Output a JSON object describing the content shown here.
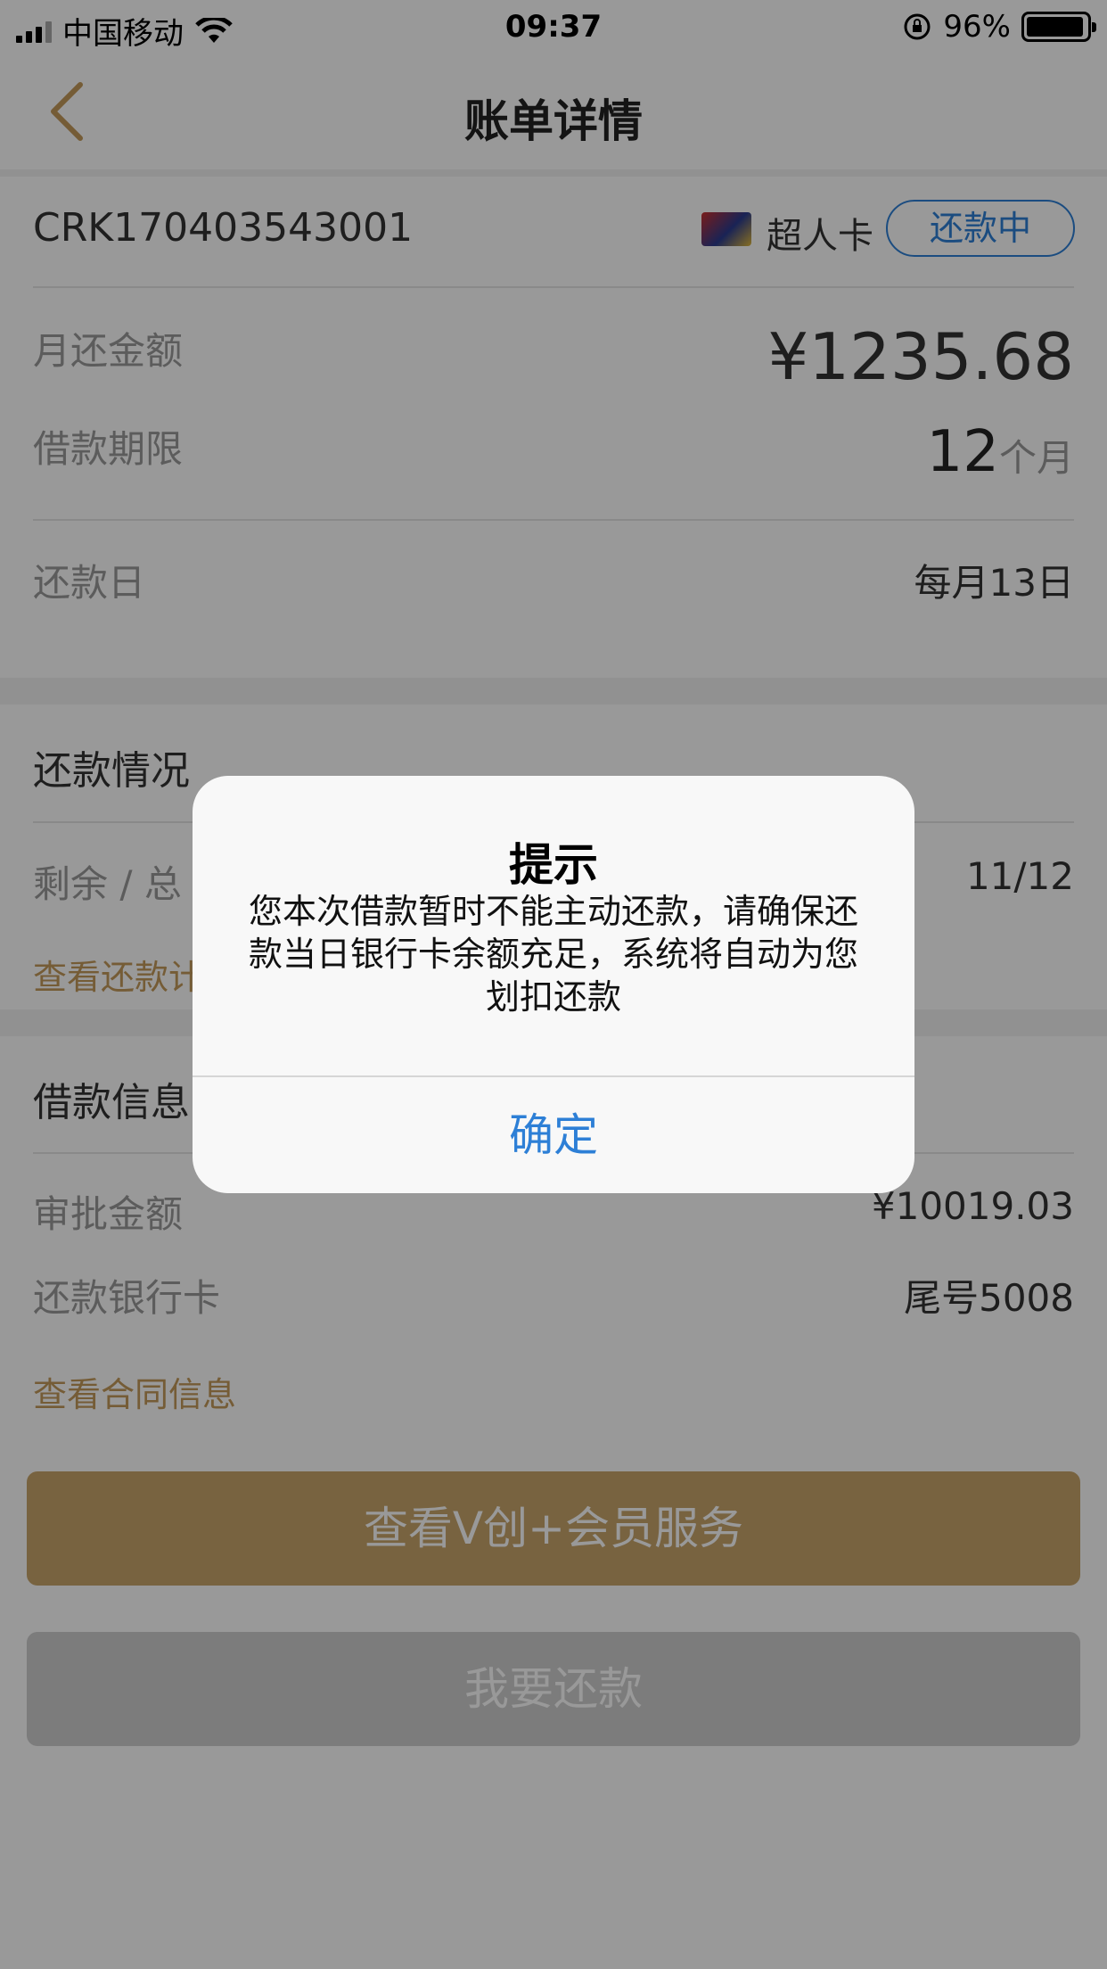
{
  "status_bar": {
    "carrier": "中国移动",
    "time": "09:37",
    "battery": "96%"
  },
  "nav": {
    "title": "账单详情"
  },
  "summary": {
    "order_no": "CRK170403543001",
    "card_name": "超人卡",
    "status": "还款中",
    "monthly_label": "月还金额",
    "monthly_value": "¥1235.68",
    "term_label": "借款期限",
    "term_number": "12",
    "term_unit": "个月",
    "due_label": "还款日",
    "due_value": "每月13日"
  },
  "repayment": {
    "title": "还款情况",
    "remaining_label": "剩余 / 总",
    "remaining_value": "11/12",
    "plan_link": "查看还款计"
  },
  "loan": {
    "title": "借款信息",
    "approved_label": "审批金额",
    "approved_value": "¥10019.03",
    "bank_label": "还款银行卡",
    "bank_value": "尾号5008",
    "contract_link": "查看合同信息"
  },
  "buttons": {
    "member": "查看V创+会员服务",
    "repay": "我要还款"
  },
  "alert": {
    "title": "提示",
    "message": "您本次借款暂时不能主动还款，请确保还款当日银行卡余额充足，系统将自动为您划扣还款",
    "confirm": "确定"
  },
  "colors": {
    "accent_gold": "#c9a56c",
    "link_gold": "#c49a5b",
    "blue": "#2d7fd6"
  }
}
